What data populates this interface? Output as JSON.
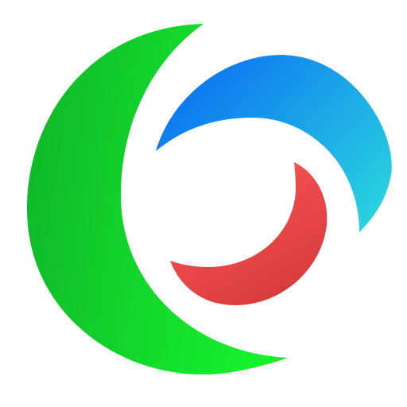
{
  "logo": {
    "shapes": [
      {
        "name": "green-crescent",
        "colors": {
          "start": "#0fb52a",
          "end": "#16f02c"
        }
      },
      {
        "name": "blue-swoosh",
        "colors": {
          "start": "#0a6ff2",
          "end": "#2bd6de"
        }
      },
      {
        "name": "red-crescent",
        "colors": {
          "start": "#ff5a5a",
          "end": "#d93b3b"
        }
      }
    ],
    "background": "#ffffff"
  }
}
